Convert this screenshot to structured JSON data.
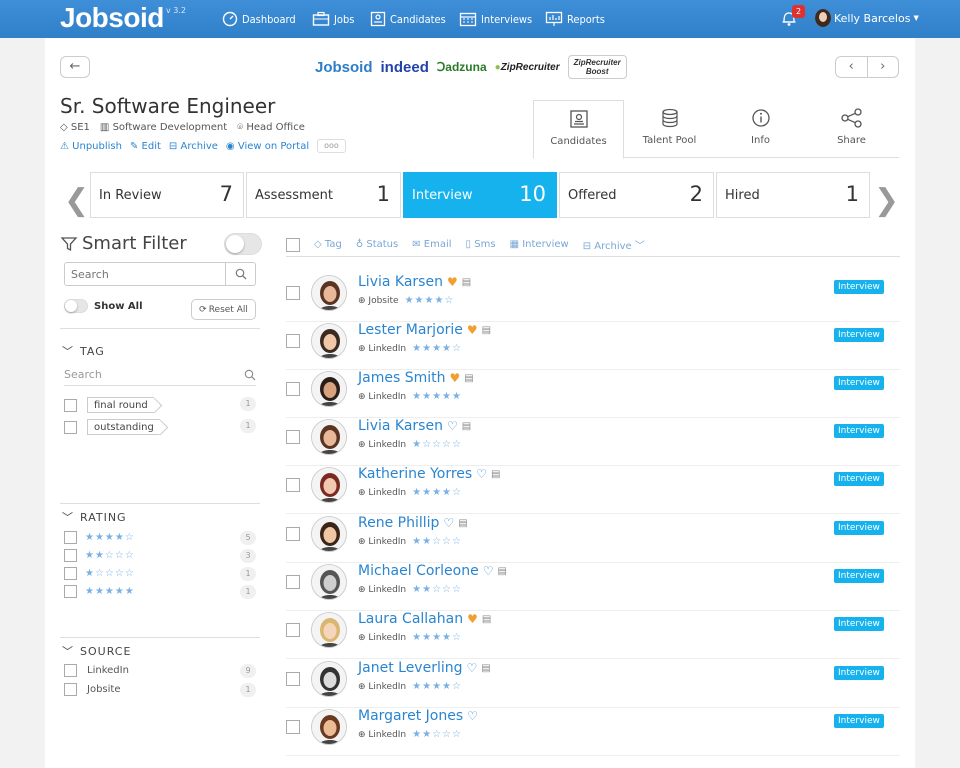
{
  "app": {
    "logo": "Jobsoid",
    "version": "v 3.2"
  },
  "nav": [
    {
      "label": "Dashboard",
      "icon": "dashboard-icon"
    },
    {
      "label": "Jobs",
      "icon": "briefcase-icon"
    },
    {
      "label": "Candidates",
      "icon": "candidates-icon"
    },
    {
      "label": "Interviews",
      "icon": "calendar-icon"
    },
    {
      "label": "Reports",
      "icon": "reports-icon"
    }
  ],
  "notifications": {
    "count": "2"
  },
  "user": {
    "name": "Kelly Barcelos"
  },
  "job_boards": {
    "jobsoid": "Jobsoid",
    "indeed": "indeed",
    "adzuna": "adzuna",
    "ziprecruiter": "ZipRecruiter",
    "zipboost_1": "ZipRecruiter",
    "zipboost_2": "Boost"
  },
  "job": {
    "title": "Sr. Software Engineer",
    "code": "SE1",
    "department": "Software Development",
    "location": "Head Office",
    "actions": {
      "unpublish": "Unpublish",
      "edit": "Edit",
      "archive": "Archive",
      "portal": "View on Portal",
      "more": "ooo"
    }
  },
  "view_tabs": [
    {
      "label": "Candidates",
      "icon": "candidates-card-icon",
      "active": true
    },
    {
      "label": "Talent Pool",
      "icon": "database-icon"
    },
    {
      "label": "Info",
      "icon": "info-icon"
    },
    {
      "label": "Share",
      "icon": "share-icon"
    }
  ],
  "stages": [
    {
      "name": "In Review",
      "count": "7"
    },
    {
      "name": "Assessment",
      "count": "1"
    },
    {
      "name": "Interview",
      "count": "10",
      "active": true
    },
    {
      "name": "Offered",
      "count": "2"
    },
    {
      "name": "Hired",
      "count": "1"
    }
  ],
  "smart_filter": {
    "title": "Smart Filter",
    "search_placeholder": "Search",
    "show_all": "Show All",
    "reset": "Reset All",
    "tag": {
      "heading": "TAG",
      "search_placeholder": "Search",
      "items": [
        {
          "label": "final round",
          "count": "1"
        },
        {
          "label": "outstanding",
          "count": "1"
        }
      ]
    },
    "rating": {
      "heading": "RATING",
      "items": [
        {
          "stars": "★★★★☆",
          "count": "5"
        },
        {
          "stars": "★★☆☆☆",
          "count": "3"
        },
        {
          "stars": "★☆☆☆☆",
          "count": "1"
        },
        {
          "stars": "★★★★★",
          "count": "1"
        }
      ]
    },
    "source": {
      "heading": "SOURCE",
      "items": [
        {
          "label": "LinkedIn",
          "count": "9"
        },
        {
          "label": "Jobsite",
          "count": "1"
        }
      ]
    }
  },
  "toolbar": {
    "tag": "Tag",
    "status": "Status",
    "email": "Email",
    "sms": "Sms",
    "interview": "Interview",
    "archive": "Archive"
  },
  "candidates": [
    {
      "name": "Livia Karsen",
      "source": "Jobsite",
      "stars": "★★★★☆",
      "fav": true,
      "note": true,
      "status": "Interview",
      "skin": "#e8b89a",
      "hair": "#5a3422"
    },
    {
      "name": "Lester Marjorie",
      "source": "LinkedIn",
      "stars": "★★★★☆",
      "fav": true,
      "note": true,
      "status": "Interview",
      "skin": "#f0c8a8",
      "hair": "#3a2a20"
    },
    {
      "name": "James Smith",
      "source": "LinkedIn",
      "stars": "★★★★★",
      "fav": true,
      "note": true,
      "status": "Interview",
      "skin": "#d9a27e",
      "hair": "#2a1e18"
    },
    {
      "name": "Livia Karsen",
      "source": "LinkedIn",
      "stars": "★☆☆☆☆",
      "fav": false,
      "note": true,
      "status": "Interview",
      "skin": "#e8b89a",
      "hair": "#5a3422"
    },
    {
      "name": "Katherine Yorres",
      "source": "LinkedIn",
      "stars": "★★★★☆",
      "fav": false,
      "note": true,
      "status": "Interview",
      "skin": "#f2c9b0",
      "hair": "#7a2a20"
    },
    {
      "name": "Rene Phillip",
      "source": "LinkedIn",
      "stars": "★★☆☆☆",
      "fav": false,
      "note": true,
      "status": "Interview",
      "skin": "#f0c7a5",
      "hair": "#3b2418"
    },
    {
      "name": "Michael Corleone",
      "source": "LinkedIn",
      "stars": "★★☆☆☆",
      "fav": false,
      "note": true,
      "status": "Interview",
      "skin": "#cfcfcf",
      "hair": "#555555"
    },
    {
      "name": "Laura Callahan",
      "source": "LinkedIn",
      "stars": "★★★★☆",
      "fav": true,
      "note": true,
      "status": "Interview",
      "skin": "#f5d6bc",
      "hair": "#d9b770"
    },
    {
      "name": "Janet Leverling",
      "source": "LinkedIn",
      "stars": "★★★★☆",
      "fav": false,
      "note": true,
      "status": "Interview",
      "skin": "#dcdcdc",
      "hair": "#333333"
    },
    {
      "name": "Margaret Jones",
      "source": "LinkedIn",
      "stars": "★★☆☆☆",
      "fav": false,
      "note": false,
      "status": "Interview",
      "skin": "#ecbc96",
      "hair": "#6a3a20"
    }
  ],
  "colors": {
    "brand": "#2f7fc9",
    "accent": "#16b2ee",
    "link": "#2a85d0",
    "heart": "#f0a030",
    "star": "#7ab1e3"
  }
}
